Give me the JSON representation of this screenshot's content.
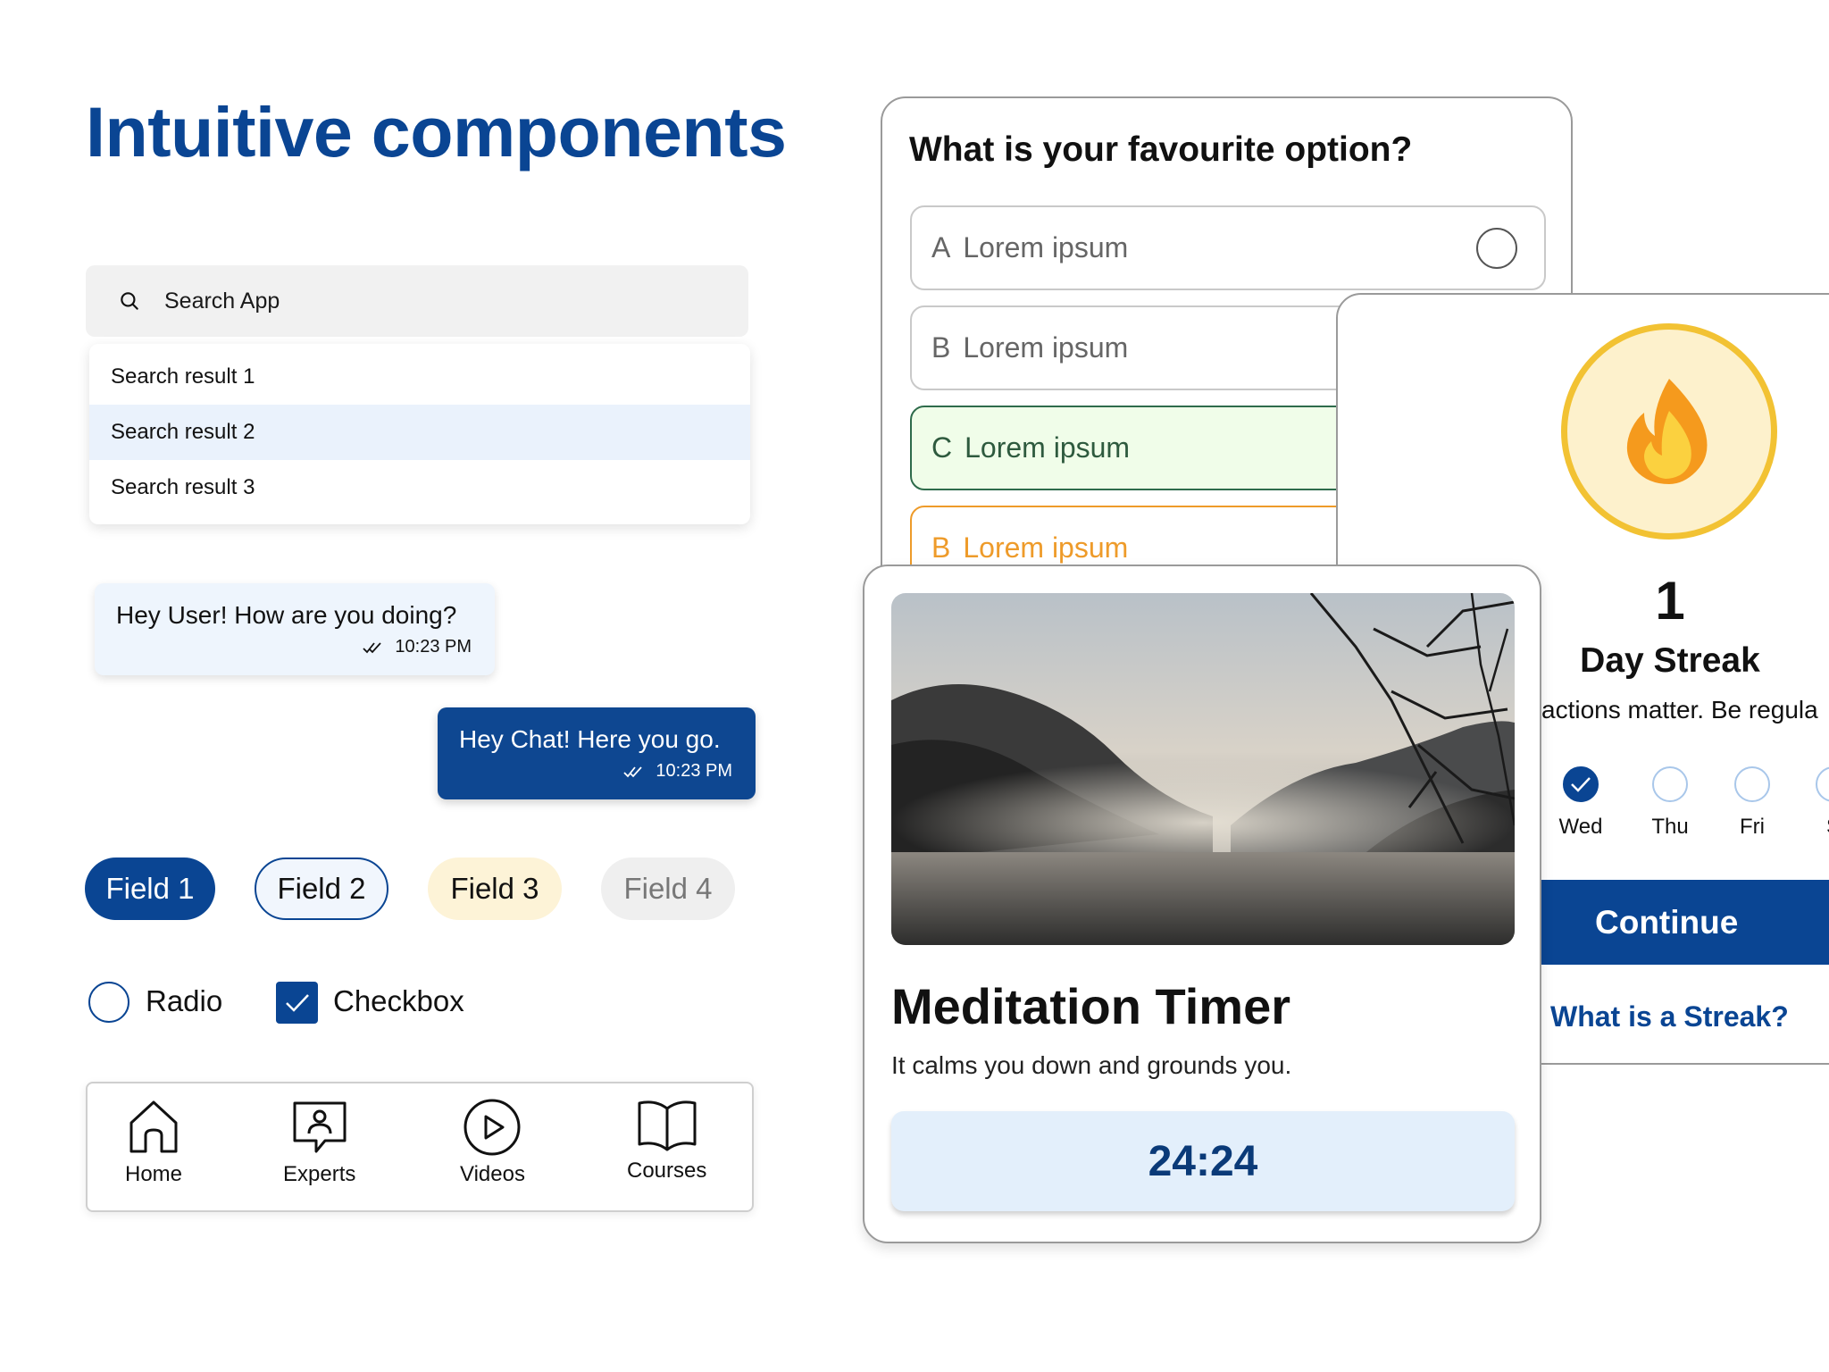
{
  "heading": {
    "title": "Intuitive components"
  },
  "search": {
    "placeholder": "Search App",
    "results": [
      "Search result 1",
      "Search result 2",
      "Search result 3"
    ]
  },
  "chat": {
    "incoming": {
      "text": "Hey User! How are you doing?",
      "time": "10:23 PM"
    },
    "outgoing": {
      "text": "Hey Chat! Here you go.",
      "time": "10:23 PM"
    }
  },
  "chips": [
    "Field 1",
    "Field 2",
    "Field 3",
    "Field 4"
  ],
  "controls": {
    "radio_label": "Radio",
    "checkbox_label": "Checkbox",
    "checkbox_checked": true
  },
  "bottom_nav": {
    "items": [
      {
        "label": "Home",
        "icon": "home-icon"
      },
      {
        "label": "Experts",
        "icon": "experts-icon"
      },
      {
        "label": "Videos",
        "icon": "play-icon"
      },
      {
        "label": "Courses",
        "icon": "book-icon"
      }
    ]
  },
  "quiz": {
    "question": "What is your favourite option?",
    "options": [
      {
        "letter": "A",
        "text": "Lorem ipsum"
      },
      {
        "letter": "B",
        "text": "Lorem ipsum"
      },
      {
        "letter": "C",
        "text": "Lorem ipsum"
      },
      {
        "letter": "B",
        "text": "Lorem ipsum"
      }
    ]
  },
  "streak": {
    "icon": "flame-icon",
    "count": "1",
    "title": "Day Streak",
    "subtitle": "actions matter. Be regula",
    "days": [
      {
        "label": "Wed",
        "done": true
      },
      {
        "label": "Thu",
        "done": false
      },
      {
        "label": "Fri",
        "done": false
      },
      {
        "label": "S",
        "done": false
      }
    ],
    "continue_label": "Continue",
    "link_label": "What is a Streak?"
  },
  "meditation": {
    "title": "Meditation Timer",
    "subtitle": "It calms you down and grounds you.",
    "timer": "24:24"
  },
  "colors": {
    "brand": "#0a4593",
    "chat_in_bg": "#eef5fd",
    "correct_bg": "#f0fde9",
    "warning": "#ee9b2a",
    "flame_ring": "#f2c233"
  }
}
